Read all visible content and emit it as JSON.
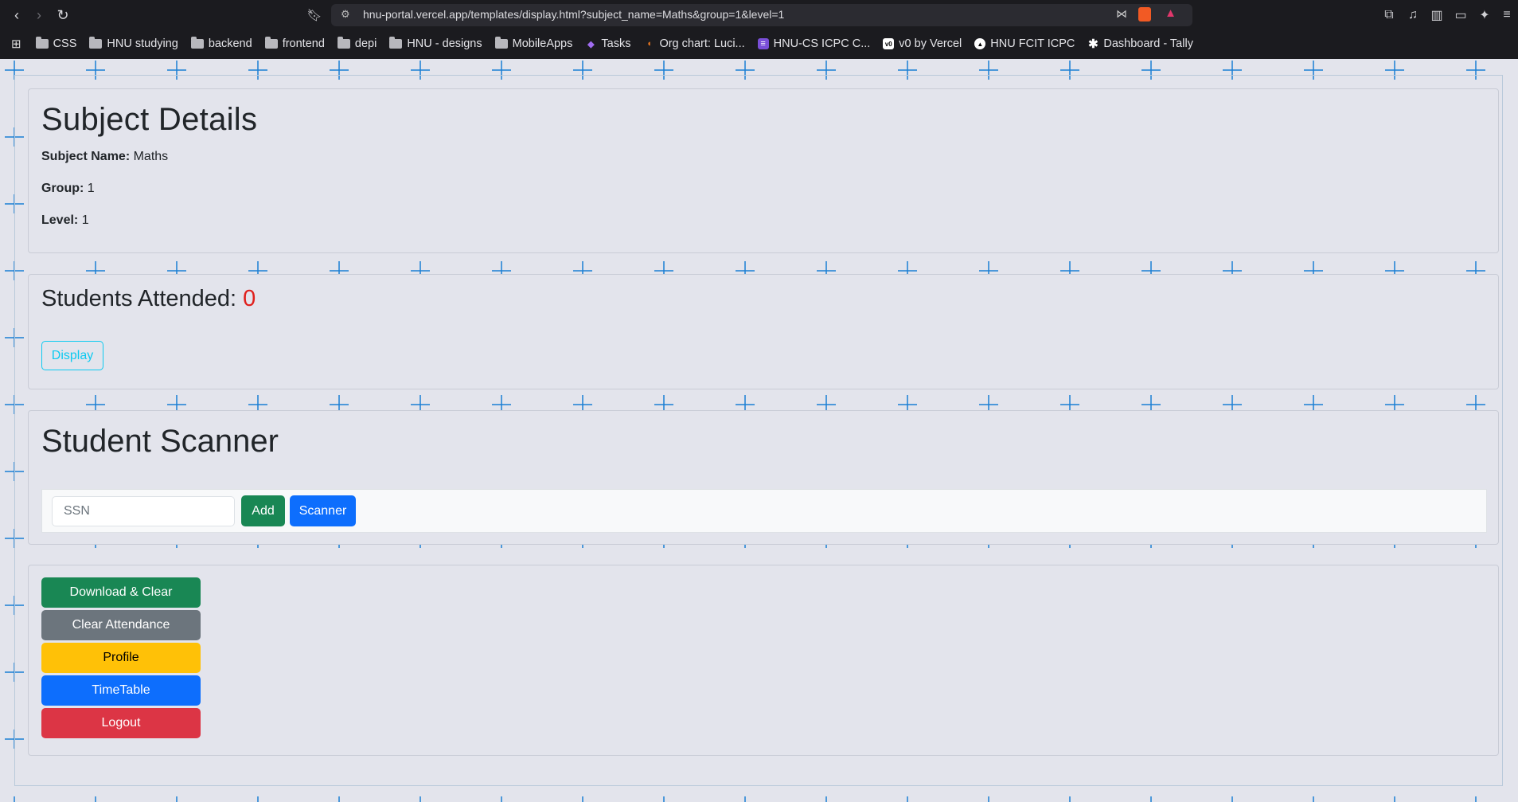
{
  "browser": {
    "url": "hnu-portal.vercel.app/templates/display.html?subject_name=Maths&group=1&level=1",
    "bookmarks": [
      {
        "label": "CSS",
        "icon": "folder-icon"
      },
      {
        "label": "HNU studying",
        "icon": "folder-icon"
      },
      {
        "label": "backend",
        "icon": "folder-icon"
      },
      {
        "label": "frontend",
        "icon": "folder-icon"
      },
      {
        "label": "depi",
        "icon": "folder-icon"
      },
      {
        "label": "HNU - designs",
        "icon": "folder-icon"
      },
      {
        "label": "MobileApps",
        "icon": "folder-icon"
      },
      {
        "label": "Tasks",
        "icon": "tasks-icon"
      },
      {
        "label": "Org chart: Luci...",
        "icon": "lucid-icon"
      },
      {
        "label": "HNU-CS ICPC C...",
        "icon": "list-icon"
      },
      {
        "label": "v0 by Vercel",
        "icon": "v0-icon"
      },
      {
        "label": "HNU FCIT ICPC",
        "icon": "triangle-icon"
      },
      {
        "label": "Dashboard - Tally",
        "icon": "tally-icon"
      }
    ]
  },
  "subject": {
    "title": "Subject Details",
    "name_label": "Subject Name:",
    "name_value": "Maths",
    "group_label": "Group:",
    "group_value": "1",
    "level_label": "Level:",
    "level_value": "1"
  },
  "attendance": {
    "label": "Students Attended:",
    "count": "0",
    "display_button": "Display"
  },
  "scanner": {
    "title": "Student Scanner",
    "ssn_placeholder": "SSN",
    "add_button": "Add",
    "scanner_button": "Scanner"
  },
  "actions": {
    "download_clear": "Download & Clear",
    "clear_attendance": "Clear Attendance",
    "profile": "Profile",
    "timetable": "TimeTable",
    "logout": "Logout"
  },
  "colors": {
    "success": "#198754",
    "secondary": "#6c757d",
    "warning": "#ffc107",
    "primary": "#0d6efd",
    "danger": "#dc3545",
    "info": "#0dcaf0",
    "count_red": "#e0201d"
  }
}
